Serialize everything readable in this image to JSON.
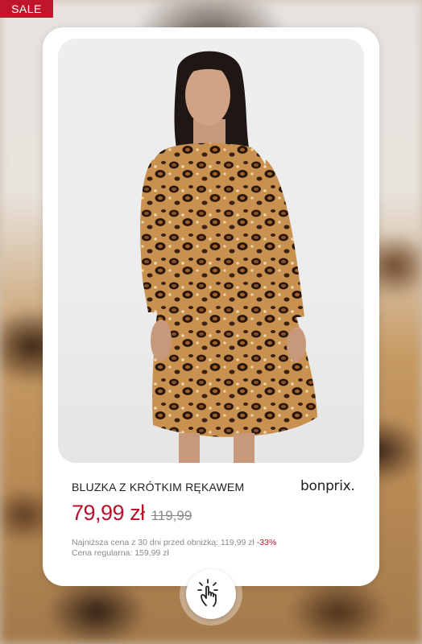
{
  "badge": {
    "label": "SALE",
    "color": "#c0162c"
  },
  "product": {
    "name": "BLUZKA Z KRÓTKIM RĘKAWEM",
    "brand": "bonprix.",
    "price_current": "79,99 zł",
    "price_old": "119,99",
    "lowest_price_text": "Najniższa cena z 30 dni przed obniżką: 119,99 zł",
    "discount": "-33%",
    "regular_price_text": "Cena regularna: 159,99 zł",
    "image_icon": "leopard-print-dress-photo"
  },
  "colors": {
    "price": "#b7122a",
    "accent": "#c0162c"
  },
  "cta": {
    "icon": "tap-hand-icon"
  }
}
